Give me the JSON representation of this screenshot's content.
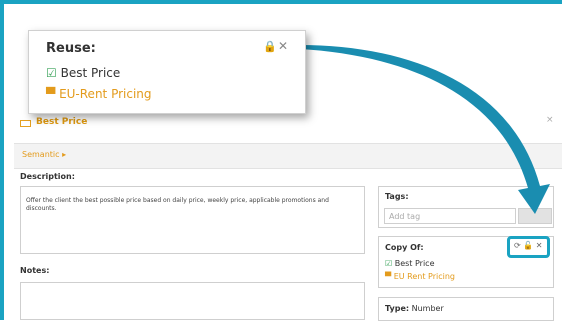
{
  "panel": {
    "title": "Best Price",
    "close": "×",
    "semantic": "Semantic ▸",
    "description_label": "Description:",
    "description_text": "Offer the client the best possible price based on daily price, weekly price, applicable promotions and discounts.",
    "notes_label": "Notes:",
    "tags_label": "Tags:",
    "tags_placeholder": "Add tag",
    "copy_of_label": "Copy Of:",
    "copy_items": [
      "Best Price",
      "EU Rent Pricing"
    ],
    "type_label": "Type:",
    "type_value": "Number"
  },
  "popup": {
    "title": "Reuse:",
    "items": [
      "Best Price",
      "EU-Rent Pricing"
    ]
  },
  "colors": {
    "accent": "#1aa3c2",
    "orange": "#e39b1c",
    "green": "#3aa35a"
  },
  "icons": [
    "lock-icon",
    "close-icon",
    "check-icon",
    "rule-icon",
    "refresh-icon",
    "unlock-icon"
  ]
}
